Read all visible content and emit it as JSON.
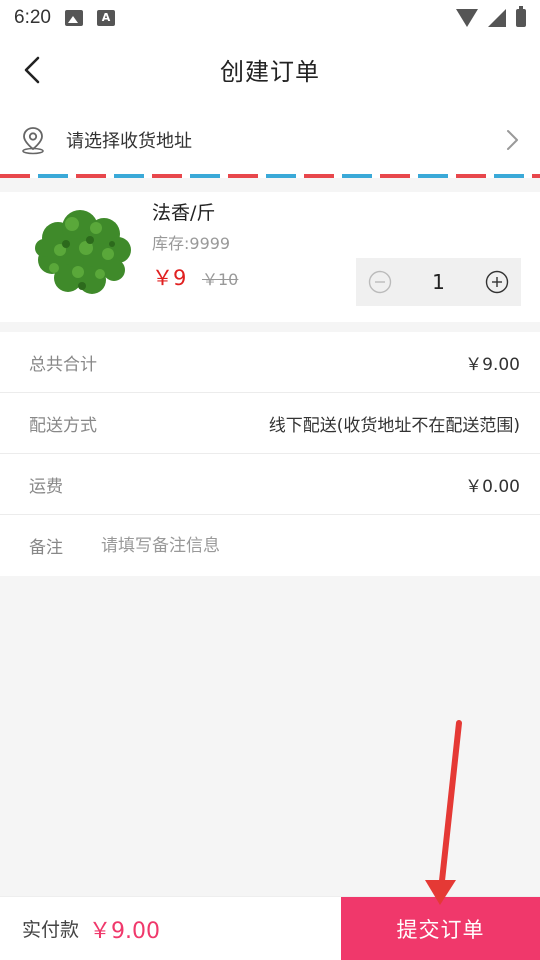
{
  "status_bar": {
    "time": "6:20"
  },
  "header": {
    "title": "创建订单"
  },
  "address": {
    "placeholder": "请选择收货地址"
  },
  "product": {
    "name": "法香/斤",
    "stock": "库存:9999",
    "price": "￥9",
    "original_price": "￥10",
    "quantity": "1"
  },
  "summary": {
    "total_label": "总共合计",
    "total_value": "￥9.00",
    "delivery_label": "配送方式",
    "delivery_value": "线下配送(收货地址不在配送范围)",
    "freight_label": "运费",
    "freight_value": "￥0.00",
    "remark_label": "备注",
    "remark_placeholder": "请填写备注信息"
  },
  "footer": {
    "pay_label": "实付款",
    "pay_amount": "￥9.00",
    "submit_label": "提交订单"
  },
  "colors": {
    "accent": "#f0386b",
    "price_red": "#e02020",
    "annotation_arrow": "#e53935",
    "stripe_red": "#e8474c",
    "stripe_blue": "#3aa9d8"
  }
}
